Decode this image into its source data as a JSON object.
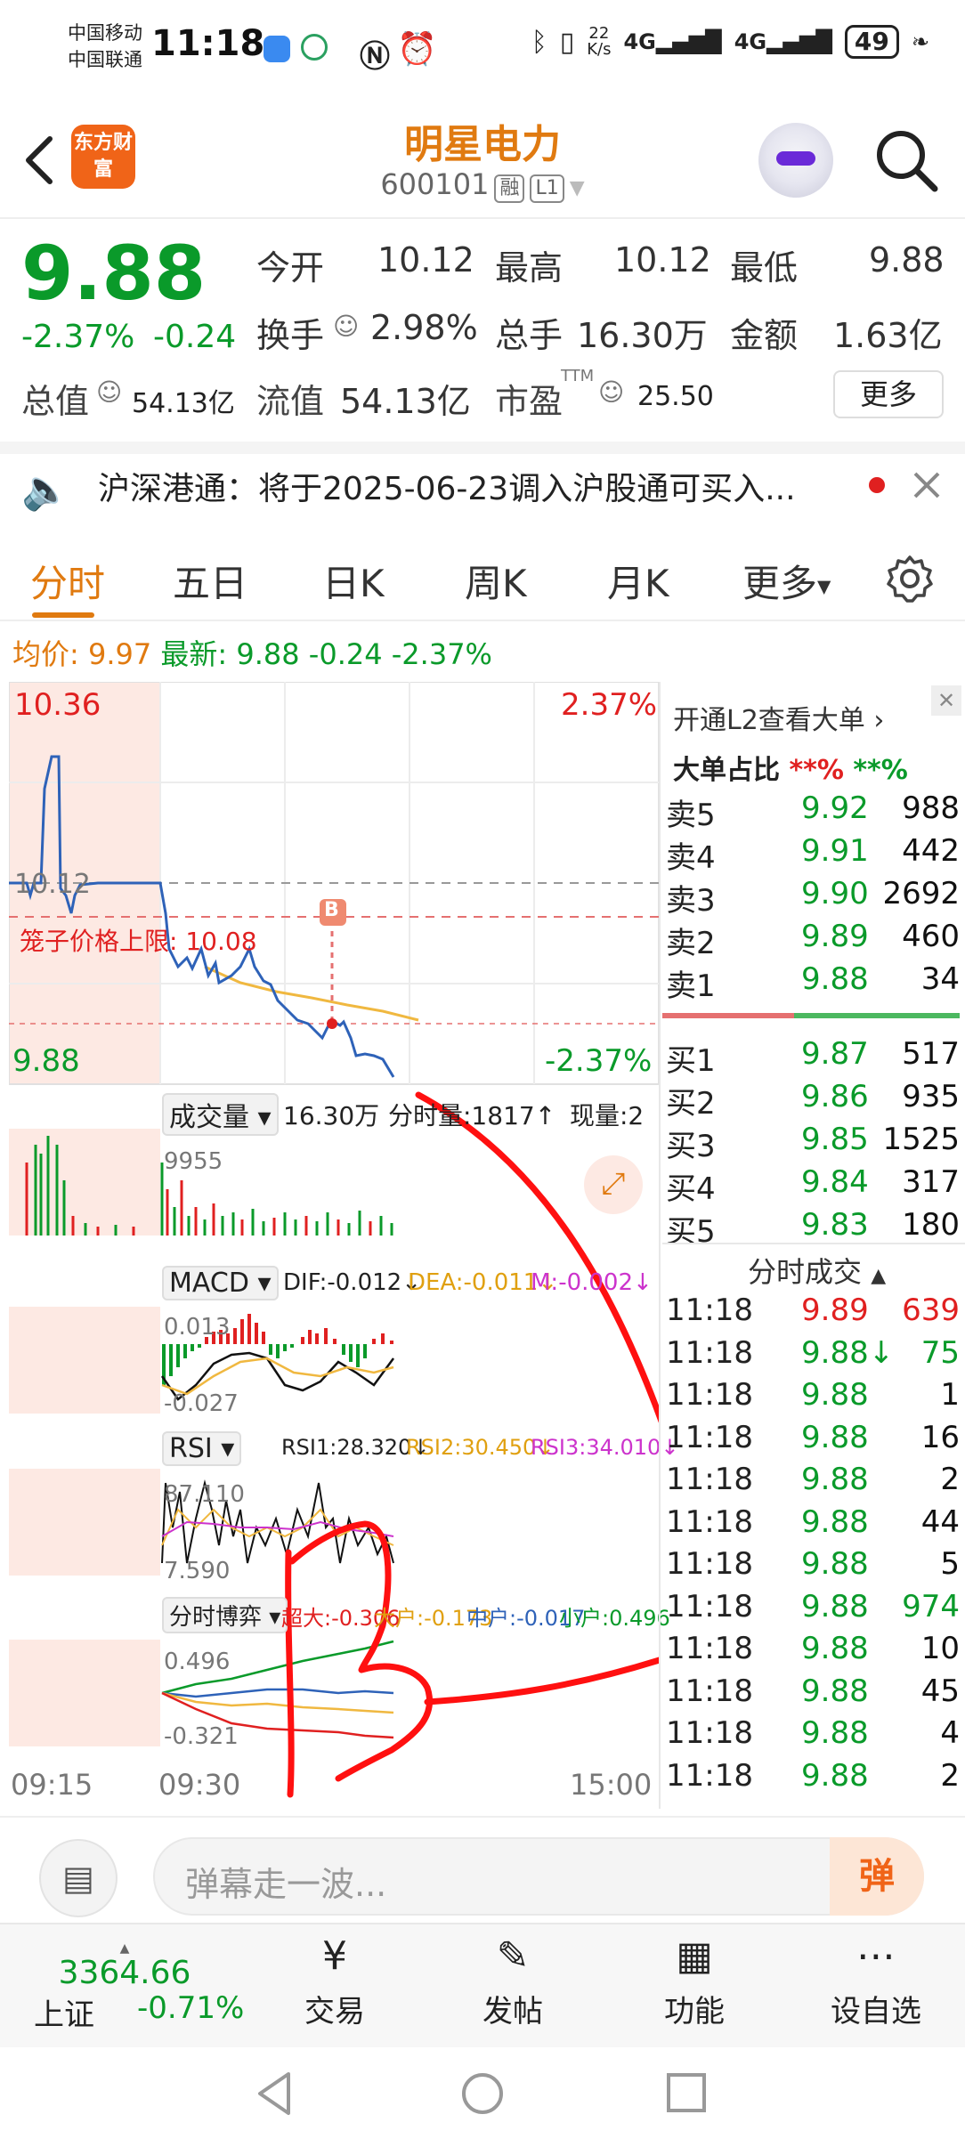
{
  "status_bar": {
    "carrier1": "中国移动",
    "carrier2": "中国联通",
    "time": "11:18",
    "net_speed_top": "22",
    "net_speed_bottom": "K/s",
    "signal1": "4G",
    "signal2": "4G",
    "battery": "49"
  },
  "header": {
    "back_icon": "chevron-left-icon",
    "app_logo": "东方财富",
    "stock_name": "明星电力",
    "stock_code": "600101",
    "tag_margin": "融",
    "tag_level": "L1",
    "search_icon": "search-icon"
  },
  "quote": {
    "price": "9.88",
    "change_pct": "-2.37%",
    "change": "-0.24",
    "open_label": "今开",
    "open": "10.12",
    "high_label": "最高",
    "high": "10.12",
    "low_label": "最低",
    "low": "9.88",
    "turnover_label": "换手",
    "turnover": "2.98%",
    "volume_label": "总手",
    "volume": "16.30万",
    "amount_label": "金额",
    "amount": "1.63亿",
    "mktcap_label": "总值",
    "mktcap": "54.13亿",
    "float_label": "流值",
    "float_cap": "54.13亿",
    "pe_label": "市盈",
    "pe_sup": "TTM",
    "pe": "25.50",
    "more_label": "更多"
  },
  "banner": {
    "text": "沪深港通：将于2025-06-23调入沪股通可买入..."
  },
  "tabs": [
    "分时",
    "五日",
    "日K",
    "周K",
    "月K",
    "更多"
  ],
  "summary": {
    "avg_label": "均价:",
    "avg": "9.97",
    "latest_label": "最新:",
    "latest": "9.88",
    "chg": "-0.24",
    "chg_pct": "-2.37%"
  },
  "chart_labels": {
    "top_price": "10.36",
    "top_pct": "2.37%",
    "mid_price": "10.12",
    "limit_label": "笼子价格上限:",
    "limit_value": "10.08",
    "bottom_price": "9.88",
    "bottom_pct": "-2.37%",
    "bs_marker": "B",
    "vol_selector": "成交量",
    "vol_total": "16.30万",
    "vol_time": "分时量:1817↑",
    "vol_now": "现量:2",
    "vol_axis": "9955",
    "macd_selector": "MACD",
    "macd_dif": "DIF:-0.012↓",
    "macd_dea": "DEA:-0.011↓",
    "macd_m": "M:-0.002↓",
    "macd_top": "0.013",
    "macd_bottom": "-0.027",
    "rsi_selector": "RSI",
    "rsi1": "RSI1:28.320↓",
    "rsi2": "RSI2:30.450↓",
    "rsi3": "RSI3:34.010↓",
    "rsi_top": "87.110",
    "rsi_bottom": "7.590",
    "game_selector": "分时博弈",
    "game_super": "超大:-0.306",
    "game_big": "大户:-0.173",
    "game_mid": "中户:-0.017",
    "game_small": "小户:0.496",
    "game_top": "0.496",
    "game_bottom": "-0.321",
    "time_start": "09:15",
    "time_open": "09:30",
    "time_end": "15:00"
  },
  "order_book": {
    "promo": "开通L2查看大单",
    "big_label": "大单占比",
    "big_sell": "**%",
    "big_buy": "**%",
    "asks": [
      {
        "label": "卖5",
        "price": "9.92",
        "vol": "988"
      },
      {
        "label": "卖4",
        "price": "9.91",
        "vol": "442"
      },
      {
        "label": "卖3",
        "price": "9.90",
        "vol": "2692"
      },
      {
        "label": "卖2",
        "price": "9.89",
        "vol": "460"
      },
      {
        "label": "卖1",
        "price": "9.88",
        "vol": "34"
      }
    ],
    "bids": [
      {
        "label": "买1",
        "price": "9.87",
        "vol": "517"
      },
      {
        "label": "买2",
        "price": "9.86",
        "vol": "935"
      },
      {
        "label": "买3",
        "price": "9.85",
        "vol": "1525"
      },
      {
        "label": "买4",
        "price": "9.84",
        "vol": "317"
      },
      {
        "label": "买5",
        "price": "9.83",
        "vol": "180"
      }
    ],
    "ticks_label": "分时成交",
    "ticks": [
      {
        "time": "11:18",
        "price": "9.89",
        "vol": "639"
      },
      {
        "time": "11:18",
        "price": "9.88↓",
        "vol": "75"
      },
      {
        "time": "11:18",
        "price": "9.88",
        "vol": "1"
      },
      {
        "time": "11:18",
        "price": "9.88",
        "vol": "16"
      },
      {
        "time": "11:18",
        "price": "9.88",
        "vol": "2"
      },
      {
        "time": "11:18",
        "price": "9.88",
        "vol": "44"
      },
      {
        "time": "11:18",
        "price": "9.88",
        "vol": "5"
      },
      {
        "time": "11:18",
        "price": "9.88",
        "vol": "974"
      },
      {
        "time": "11:18",
        "price": "9.88",
        "vol": "10"
      },
      {
        "time": "11:18",
        "price": "9.88",
        "vol": "45"
      },
      {
        "time": "11:18",
        "price": "9.88",
        "vol": "4"
      },
      {
        "time": "11:18",
        "price": "9.88",
        "vol": "2"
      }
    ]
  },
  "danmu": {
    "placeholder": "弹幕走一波...",
    "button": "弹"
  },
  "toolbar": {
    "index_value": "3364.66",
    "index_name": "上证",
    "index_change": "-0.71%",
    "items": [
      "交易",
      "发帖",
      "功能",
      "设自选"
    ]
  },
  "colors": {
    "accent": "#e07a10",
    "up": "#e02020",
    "down": "#0a9a2a",
    "handwriting": "#ff0000"
  }
}
